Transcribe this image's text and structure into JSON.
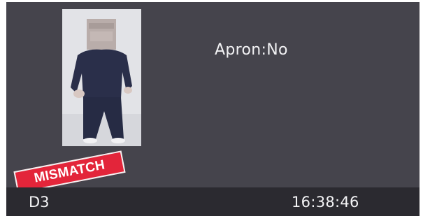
{
  "attribute": {
    "text": "Apron:No"
  },
  "match_status": {
    "text": "MISMATCH",
    "color": "#e3253a"
  },
  "footer": {
    "device": "D3",
    "time": "16:38:46"
  },
  "snapshot": {
    "icon": "person-snapshot"
  }
}
